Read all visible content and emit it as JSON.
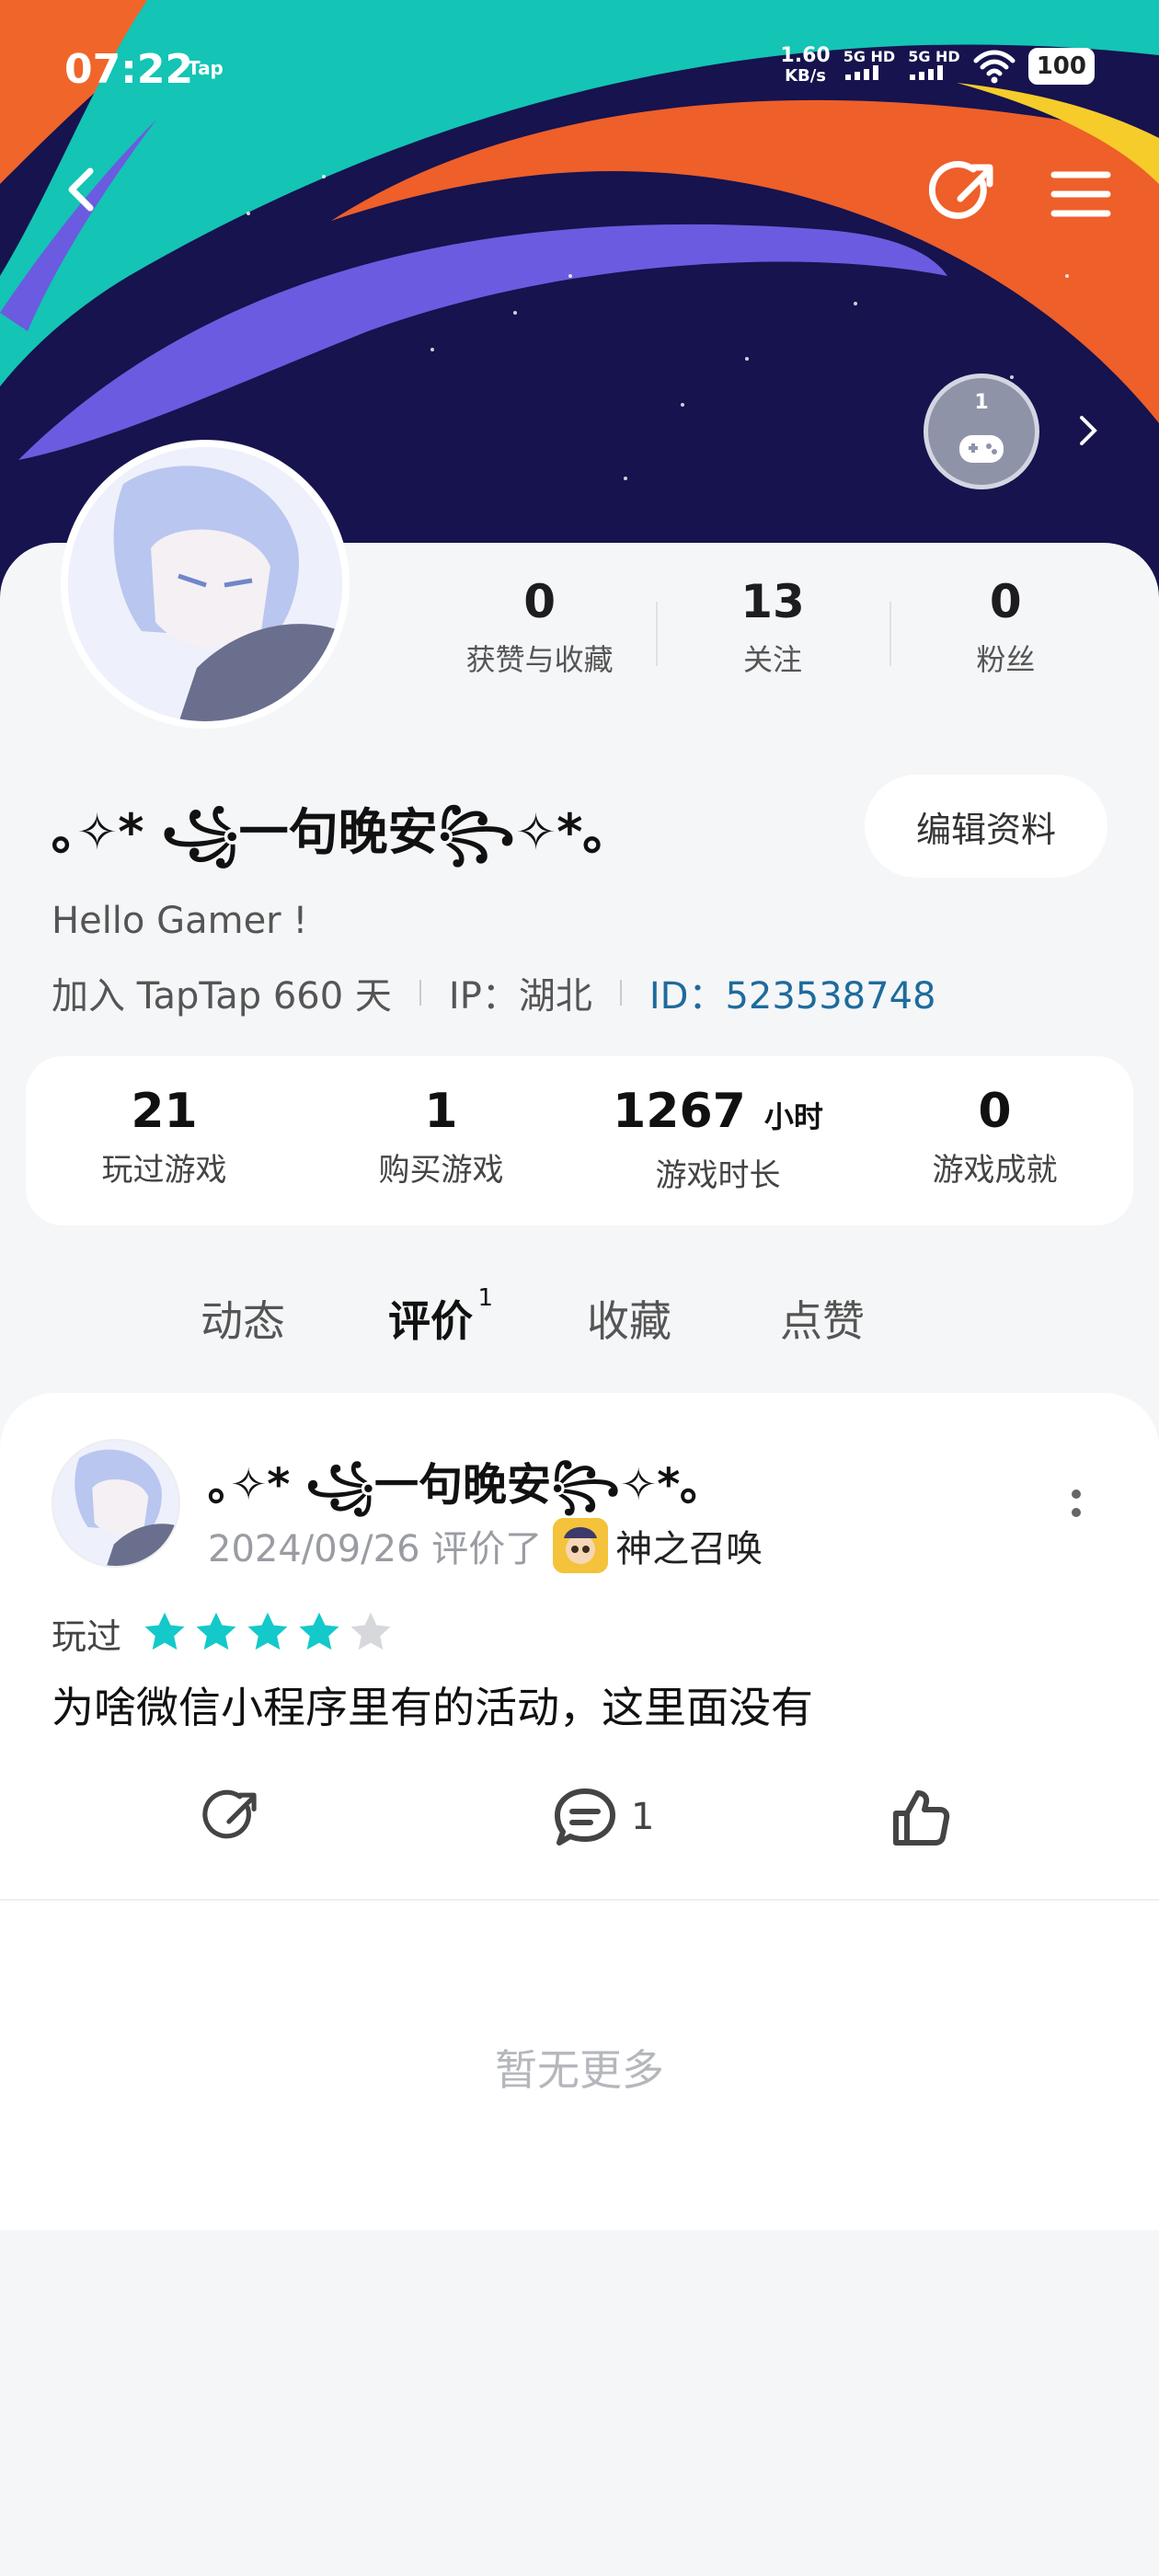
{
  "status_bar": {
    "time": "07:22",
    "app_tag": "Tap",
    "net_speed_value": "1.60",
    "net_speed_unit": "KB/s",
    "signal_1": "5G HD",
    "signal_2": "5G HD",
    "battery": "100"
  },
  "nav": {
    "back_icon": "chevron-left-icon",
    "share_icon": "share-icon",
    "menu_icon": "menu-icon"
  },
  "badge": {
    "count": "1",
    "icon": "gamepad-icon"
  },
  "profile": {
    "stats": [
      {
        "value": "0",
        "label": "获赞与收藏"
      },
      {
        "value": "13",
        "label": "关注"
      },
      {
        "value": "0",
        "label": "粉丝"
      }
    ],
    "nickname": "｡✧* ꧁一句晚安꧂✧*｡",
    "edit_label": "编辑资料",
    "bio": "Hello Gamer !",
    "joined": "加入 TapTap 660 天",
    "ip": "IP：湖北",
    "id": "ID：523538748"
  },
  "game_stats": [
    {
      "value": "21",
      "unit": "",
      "label": "玩过游戏"
    },
    {
      "value": "1",
      "unit": "",
      "label": "购买游戏"
    },
    {
      "value": "1267",
      "unit": "小时",
      "label": "游戏时长"
    },
    {
      "value": "0",
      "unit": "",
      "label": "游戏成就"
    }
  ],
  "tabs": [
    {
      "label": "动态"
    },
    {
      "label": "评价",
      "count": "1"
    },
    {
      "label": "收藏"
    },
    {
      "label": "点赞"
    }
  ],
  "post": {
    "author": "｡✧* ꧁一句晚安꧂✧*｡",
    "date_action": "2024/09/26 评价了",
    "game_name": "神之召唤",
    "rating_label": "玩过",
    "rating": 4,
    "rating_max": 5,
    "text": "为啥微信小程序里有的活动，这里面没有",
    "comment_count": "1"
  },
  "footer": {
    "no_more": "暂无更多"
  },
  "colors": {
    "accent": "#14c9c9",
    "id_link": "#1e6b9c",
    "star_on": "#14c9c9",
    "star_off": "#d6d8dc"
  }
}
